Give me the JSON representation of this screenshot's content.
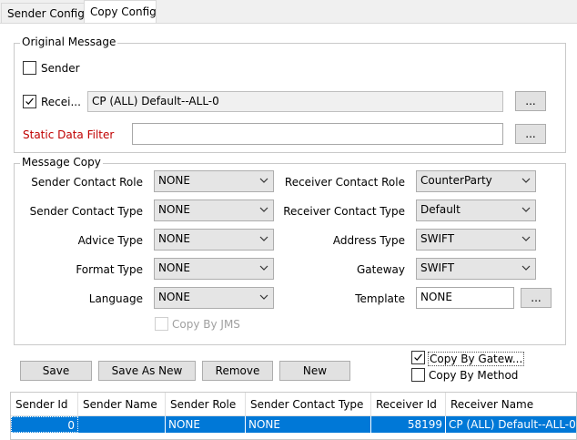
{
  "tabs": [
    {
      "label": "Sender Config",
      "active": false
    },
    {
      "label": "Copy Config",
      "active": true
    }
  ],
  "original_message": {
    "title": "Original Message",
    "sender_label": "Sender",
    "sender_checked": false,
    "receiver_label": "Recei...",
    "receiver_checked": true,
    "receiver_value": "CP (ALL) Default--ALL-0",
    "static_filter_label": "Static Data Filter",
    "static_filter_value": "",
    "browse_label": "..."
  },
  "message_copy": {
    "title": "Message Copy",
    "left_fields": [
      {
        "label": "Sender Contact Role",
        "value": "NONE"
      },
      {
        "label": "Sender Contact Type",
        "value": "NONE"
      },
      {
        "label": "Advice Type",
        "value": "NONE"
      },
      {
        "label": "Format Type",
        "value": "NONE"
      },
      {
        "label": "Language",
        "value": "NONE"
      }
    ],
    "right_fields": [
      {
        "label": "Receiver Contact Role",
        "value": "CounterParty"
      },
      {
        "label": "Receiver Contact Type",
        "value": "Default"
      },
      {
        "label": "Address Type",
        "value": "SWIFT"
      },
      {
        "label": "Gateway",
        "value": "SWIFT"
      }
    ],
    "template_label": "Template",
    "template_value": "NONE",
    "template_browse": "...",
    "copy_by_jms_label": "Copy By JMS",
    "copy_by_jms_checked": false
  },
  "actions": {
    "save": "Save",
    "save_as_new": "Save As New",
    "remove": "Remove",
    "new": "New",
    "copy_by_gateway_label": "Copy By Gatew...",
    "copy_by_gateway_checked": true,
    "copy_by_method_label": "Copy By Method",
    "copy_by_method_checked": false
  },
  "table": {
    "columns": [
      "Sender Id",
      "Sender Name",
      "Sender Role",
      "Sender Contact Type",
      "Receiver Id",
      "Receiver Name"
    ],
    "rows": [
      [
        "0",
        "",
        "NONE",
        "NONE",
        "58199",
        "CP (ALL) Default--ALL-0"
      ]
    ]
  },
  "colors": {
    "selection": "#0078d7",
    "filter_label": "#c00000"
  }
}
